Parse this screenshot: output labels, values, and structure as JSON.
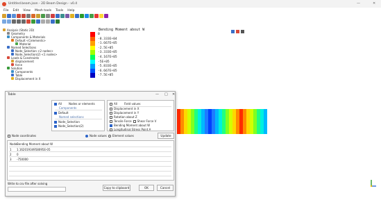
{
  "window": {
    "title": "Untitled.beam.json - 2D Beam Design - v0.4",
    "minimize": "—",
    "close": "✕"
  },
  "menu": [
    "File",
    "Edit",
    "View",
    "Mesh tools",
    "Tools",
    "Help"
  ],
  "tree": [
    "Analysis (Static 2D)",
    "Geometry",
    "Components & Materials",
    "Default <Celements>",
    "Material",
    "Named Selections",
    "Node_Selection <2 nodes>",
    "Node_Selection(2) <1 nodes>",
    "Loads & Constraints",
    "displacement",
    "force",
    "Solution",
    "Components",
    "Table",
    "Displacement in X"
  ],
  "legend": {
    "title": "Bending Moment about W",
    "values": [
      "0",
      "-8.333E+04",
      "-1.667E+05",
      "-2.5E+05",
      "-3.333E+05",
      "-4.167E+05",
      "-5E+05",
      "-5.833E+05",
      "-6.667E+05",
      "-7.5E+05"
    ],
    "colors": [
      "#ff0000",
      "#ff5a00",
      "#ffa000",
      "#ffff00",
      "#a0ff00",
      "#00ff60",
      "#00ffff",
      "#00a0ff",
      "#0050ff",
      "#0000c0"
    ]
  },
  "beam_colors": [
    "#ff2a00",
    "#ff8a00",
    "#ffd800",
    "#d4ff00",
    "#80ff20",
    "#20ff80",
    "#00f0e0",
    "#00b8ff",
    "#1f7aff",
    "#0040ff",
    "#1f7aff",
    "#00b8ff",
    "#00f0e0",
    "#20ff80",
    "#80ff20",
    "#d4ff00",
    "#ffd800",
    "#ff8a00",
    "#ff2a00",
    "#ff8a00",
    "#ffd800",
    "#d4ff00",
    "#80ff20",
    "#20ff80",
    "#00f0e0",
    "#00b8ff"
  ],
  "dialog": {
    "title": "Table",
    "left": {
      "all_label": "All",
      "nodes_label": "Nodes or elements",
      "components_header": "Components",
      "default_item": "Default",
      "named_header": "Named selections",
      "named_items": [
        "Node_Selection",
        "Node_Selection(2)"
      ]
    },
    "right": {
      "all_label": "All",
      "field_label": "Field values",
      "fields": [
        {
          "label": "Displacement in X",
          "checked": false
        },
        {
          "label": "Displacement in Y",
          "checked": false
        },
        {
          "label": "Rotation about Z",
          "checked": false
        },
        {
          "label": "Tensile Force",
          "checked": false
        },
        {
          "label": "Shear Force V",
          "checked": false
        },
        {
          "label": "Bending Moment about W",
          "checked": true
        },
        {
          "label": "Longitudinal Stress Point A",
          "checked": false
        }
      ]
    },
    "options": {
      "node_coordinates": "Node coordinates",
      "node_values": "Node values",
      "element_values": "Element values",
      "update": "Update"
    },
    "table": {
      "headers": [
        "Node",
        "Bending Moment about W"
      ],
      "rows": [
        [
          "1",
          "1.16201934958095E-05"
        ],
        [
          "2",
          "0"
        ],
        [
          "3",
          "-750000"
        ]
      ]
    },
    "footer": {
      "write_label": "Write to csv file after solving",
      "copy": "Copy to clipboard",
      "ok": "OK",
      "cancel": "Cancel"
    }
  }
}
